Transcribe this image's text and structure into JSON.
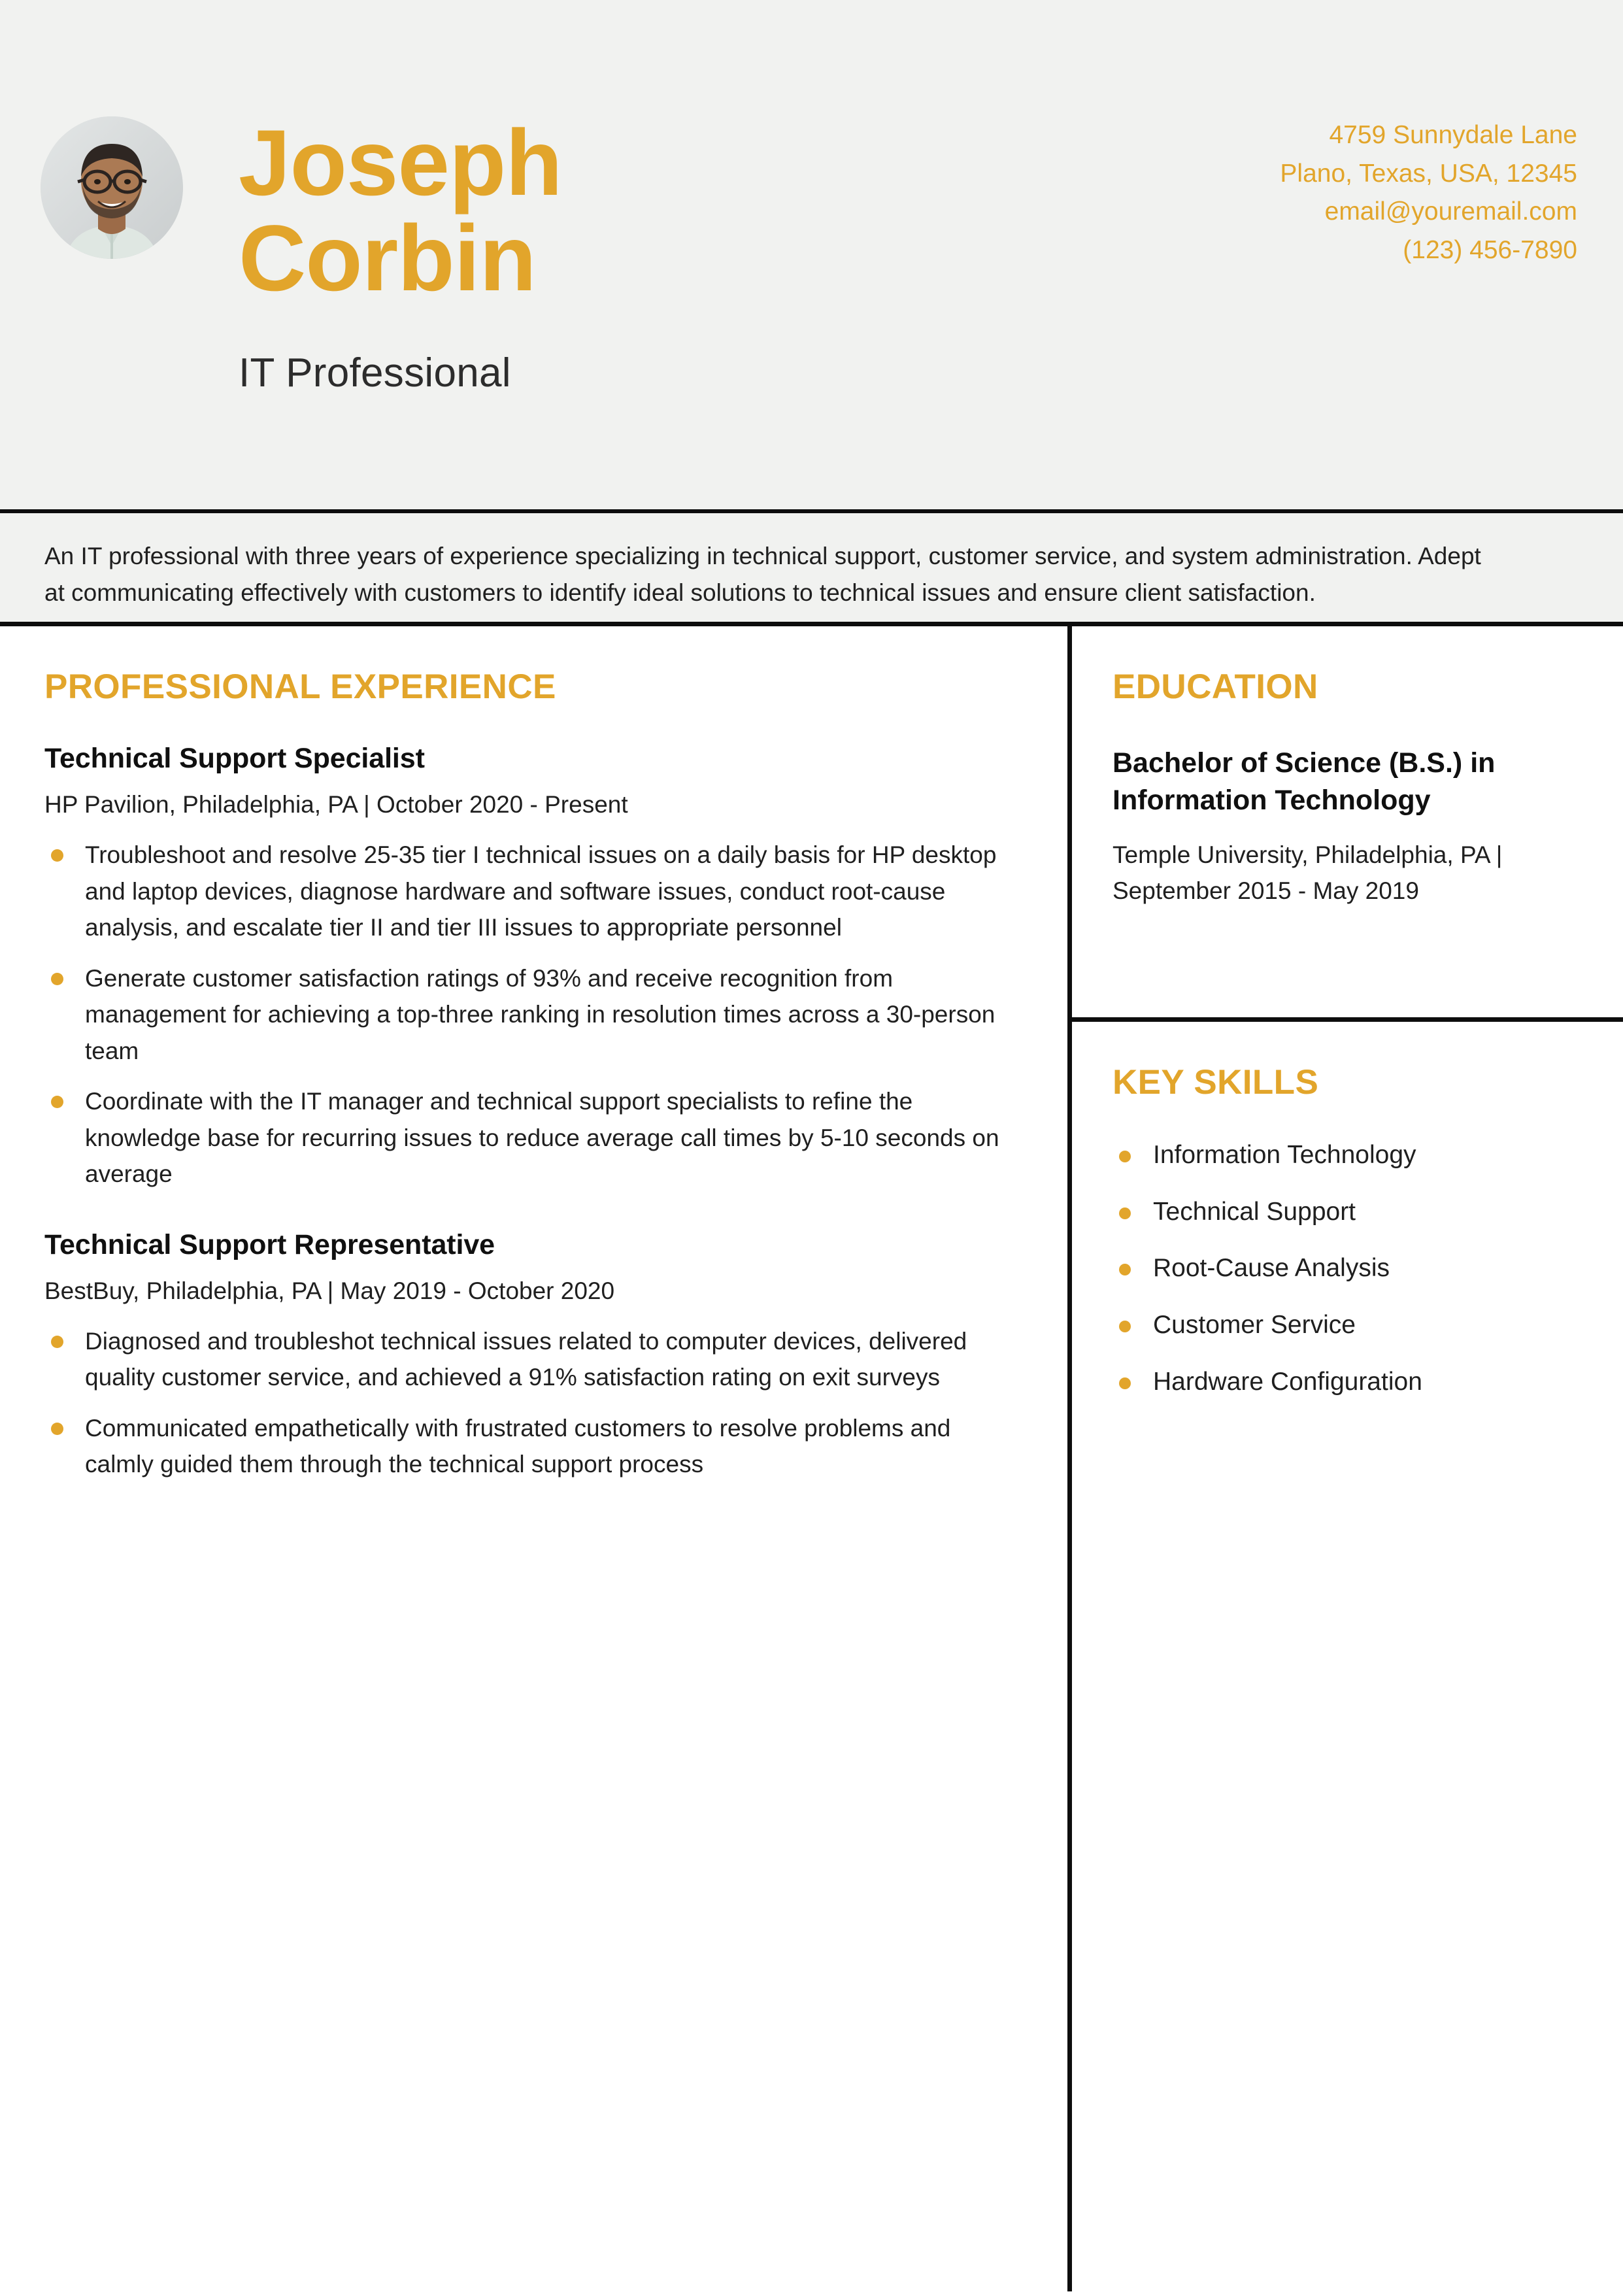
{
  "theme": {
    "accent": "#e2a52b",
    "band_background": "#f1f2f0",
    "page_background": "#ffffff",
    "rule_color": "#0d0d0d",
    "text_color": "#1f1f1f"
  },
  "header": {
    "first_name": "Joseph",
    "last_name": "Corbin",
    "full_name": "Joseph Corbin",
    "job_title": "IT Professional",
    "avatar_alt": "profile-photo",
    "contact": {
      "street": "4759 Sunnydale Lane",
      "city_state_zip": "Plano, Texas, USA, 12345",
      "email": "email@youremail.com",
      "phone": "(123) 456-7890"
    }
  },
  "summary": {
    "text": "An IT professional with three years of experience specializing in technical support, customer service, and system administration. Adept at communicating effectively with customers to identify ideal solutions to technical issues and ensure client satisfaction."
  },
  "experience": {
    "heading": "PROFESSIONAL EXPERIENCE",
    "jobs": [
      {
        "role": "Technical Support Specialist",
        "meta": "HP Pavilion, Philadelphia, PA | October 2020 - Present",
        "bullets": [
          "Troubleshoot and resolve 25-35 tier I technical issues on a daily basis for HP desktop and laptop devices, diagnose hardware and software issues, conduct root-cause analysis, and escalate tier II and tier III issues to appropriate personnel",
          "Generate customer satisfaction ratings of 93% and receive recognition from management for achieving a top-three ranking in resolution times across a 30-person team",
          "Coordinate with the IT manager and technical support specialists to refine the knowledge base for recurring issues to reduce average call times by 5-10 seconds on average"
        ]
      },
      {
        "role": "Technical Support Representative",
        "meta": "BestBuy, Philadelphia, PA | May 2019 - October 2020",
        "bullets": [
          "Diagnosed and troubleshot technical issues related to computer devices, delivered quality customer service, and achieved a 91% satisfaction rating on exit surveys",
          "Communicated empathetically with frustrated customers to resolve problems and calmly guided them through the technical support process"
        ]
      }
    ]
  },
  "education": {
    "heading": "EDUCATION",
    "entries": [
      {
        "degree": "Bachelor of Science (B.S.) in Information Technology",
        "school": "Temple University, Philadelphia, PA | September 2015 - May 2019"
      }
    ]
  },
  "skills": {
    "heading": "KEY SKILLS",
    "items": [
      "Information Technology",
      "Technical Support",
      "Root-Cause Analysis",
      "Customer Service",
      "Hardware Configuration"
    ]
  }
}
